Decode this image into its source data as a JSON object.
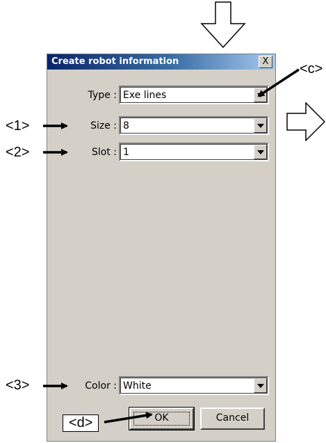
{
  "dialog": {
    "title": "Create robot information",
    "close_symbol": "X",
    "fields": {
      "type": {
        "label": "Type :",
        "value": "Exe lines"
      },
      "size": {
        "label": "Size :",
        "value": "8"
      },
      "slot": {
        "label": "Slot :",
        "value": "1"
      },
      "color": {
        "label": "Color :",
        "value": "White"
      }
    },
    "buttons": {
      "ok": "OK",
      "cancel": "Cancel"
    }
  },
  "annotations": {
    "c": "<c>",
    "one": "<1>",
    "two": "<2>",
    "three": "<3>",
    "d": "<d>"
  },
  "icons": [
    "down-arrow-outline-icon",
    "right-arrow-outline-icon",
    "close-icon",
    "dropdown-arrow-icon"
  ]
}
